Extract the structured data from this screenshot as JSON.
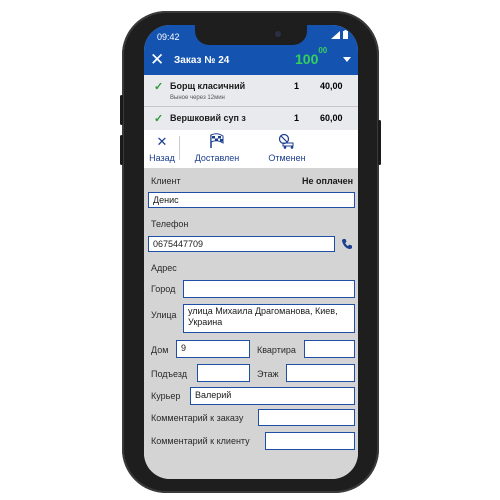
{
  "status_bar": {
    "time": "09:42"
  },
  "app_bar": {
    "title": "Заказ № 24",
    "total_main": "100",
    "total_cents": "00"
  },
  "order_items": [
    {
      "name": "Борщ класичний",
      "qty": "1",
      "price": "40,00",
      "note": "Выное через 12мин"
    },
    {
      "name": "Вершковий суп з",
      "qty": "1",
      "price": "60,00"
    }
  ],
  "toolbar": {
    "back_label": "Назад",
    "delivered_label": "Доставлен",
    "cancelled_label": "Отменен"
  },
  "form": {
    "client_label": "Клиент",
    "payment_status": "Не оплачен",
    "client_value": "Денис",
    "phone_label": "Телефон",
    "phone_value": "0675447709",
    "address_label": "Адрес",
    "city_label": "Город",
    "city_value": "",
    "street_label": "Улица",
    "street_value": "улица Михаила Драгоманова, Киев, Украина",
    "house_label": "Дом",
    "house_value": "9",
    "apartment_label": "Квартира",
    "apartment_value": "",
    "entrance_label": "Подъезд",
    "entrance_value": "",
    "floor_label": "Этаж",
    "floor_value": "",
    "courier_label": "Курьер",
    "courier_value": "Валерий",
    "order_comment_label": "Комментарий к заказу",
    "order_comment_value": "",
    "client_comment_label": "Комментарий к клиенту",
    "client_comment_value": ""
  },
  "icons": {
    "close": "close-icon",
    "dropdown": "chevron-down-icon",
    "check": "check-icon",
    "back": "x-icon",
    "delivered": "checkered-flag-icon",
    "cancelled": "cancel-delivery-icon",
    "phone": "phone-icon"
  },
  "colors": {
    "header_blue": "#1454b0",
    "total_green": "#34d15a",
    "check_green": "#2e9a3c",
    "field_border": "#1e4fa5",
    "form_bg": "#d4d4d4"
  }
}
